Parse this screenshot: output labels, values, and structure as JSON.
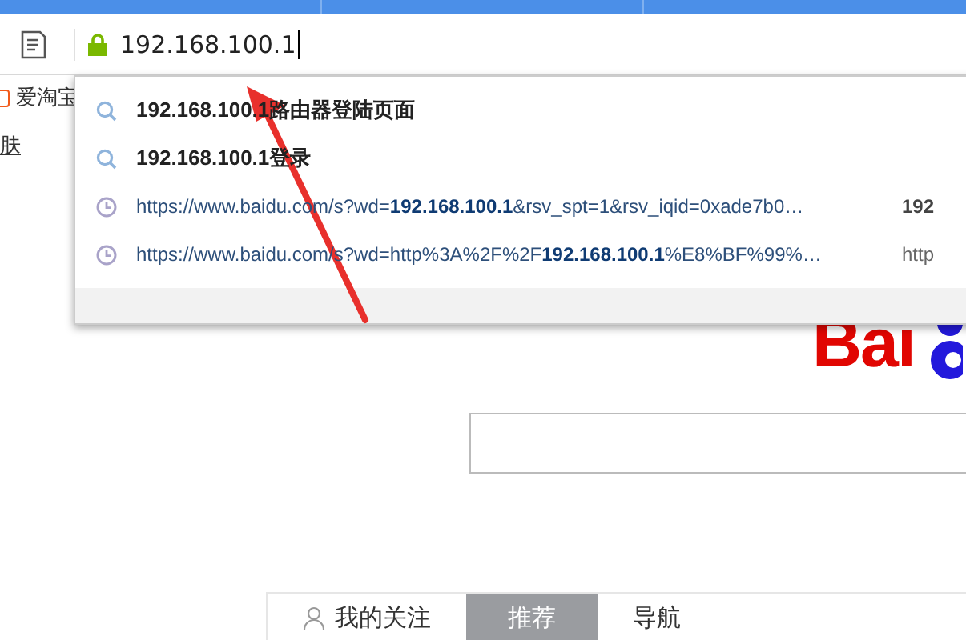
{
  "address_bar": {
    "value": "192.168.100.1"
  },
  "bookmarks": [
    {
      "label": "爱淘宝"
    }
  ],
  "page_links": [
    {
      "label": "肤"
    }
  ],
  "suggestions": [
    {
      "kind": "search",
      "text": "**192.168.100.1**路由器登陆页面"
    },
    {
      "kind": "search",
      "text": "**192.168.100.1**登录"
    },
    {
      "kind": "history",
      "text": "https://www.baidu.com/s?wd=**192.168.100.1**&rsv_spt=1&rsv_iqid=0xade7b0…",
      "side": "192",
      "side_bold": true
    },
    {
      "kind": "history",
      "text": "https://www.baidu.com/s?wd=http%3A%2F%2F**192.168.100.1**%E8%BF%99%…",
      "side": "http",
      "side_bold": false
    }
  ],
  "logo": {
    "text": "Bai"
  },
  "feed_tabs": [
    {
      "label": "我的关注",
      "selected": false
    },
    {
      "label": "推荐",
      "selected": true
    },
    {
      "label": "导航",
      "selected": false
    }
  ]
}
